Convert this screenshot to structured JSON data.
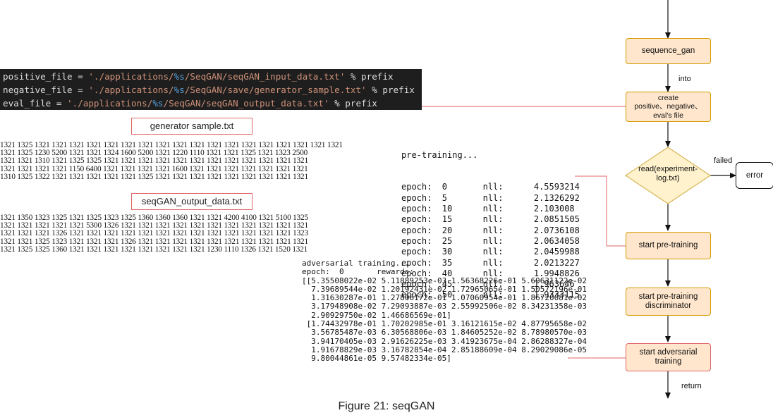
{
  "code": {
    "lines": [
      [
        {
          "t": "plain",
          "v": "positive_file = "
        },
        {
          "t": "str",
          "v": "'./applications/"
        },
        {
          "t": "fmt",
          "v": "%s"
        },
        {
          "t": "str",
          "v": "/SeqGAN/seqGAN_input_data.txt'"
        },
        {
          "t": "plain",
          "v": " % prefix"
        }
      ],
      [
        {
          "t": "plain",
          "v": "negative_file = "
        },
        {
          "t": "str",
          "v": "'./applications/"
        },
        {
          "t": "fmt",
          "v": "%s"
        },
        {
          "t": "str",
          "v": "/SeqGAN/save/generator_sample.txt'"
        },
        {
          "t": "plain",
          "v": " % prefix"
        }
      ],
      [
        {
          "t": "plain",
          "v": "eval_file = "
        },
        {
          "t": "str",
          "v": "'./applications/"
        },
        {
          "t": "fmt",
          "v": "%s"
        },
        {
          "t": "str",
          "v": "/SeqGAN/seqGAN_output_data.txt'"
        },
        {
          "t": "plain",
          "v": " % prefix"
        }
      ]
    ],
    "colors": {
      "plain": "#dcdcdc",
      "str": "#ce9178",
      "fmt": "#569cd6"
    }
  },
  "generator_label": "generator sample.txt",
  "generator_rows": [
    "1321 1325 1321 1321 1321 1321 1321 1321 1321 1321 1321 1321 1321 1321 1321 1321 1321 1321 1321 1321",
    "1321 1325 1230 5200 1321 1321 1324 1600 5200 1321 1220 1110 1321 1321 1325 1321 1323 2500",
    "1321 1321 1310 1321 1325 1325 1321 1321 1321 1321 1321 1321 1321 1321 1321 1321 1321 1321",
    "1321 1321 1321 1321 1150 6400 1321 1321 1321 1321 1600 1321 1321 1321 1321 1321 1321 1321",
    "1310 1325 1322 1321 1321 1321 1321 1321 1325 1321 1321 1321 1321 1321 1321 1321 1321 1321"
  ],
  "output_label": "seqGAN_output_data.txt",
  "output_rows": [
    "1321 1350 1323 1325 1321 1325 1323 1325 1360 1360 1360 1321 1321 4200 4100 1321 5100 1325",
    "1321 1321 1321 1321 1321 5300 1326 1321 1321 1321 1321 1321 1321 1321 1321 1321 1321 1321",
    "1321 1321 1321 1326 1321 1321 1321 1321 1321 1321 1321 1321 1321 1321 1321 1321 1321 1323",
    "1321 1321 1325 1323 1321 1321 1321 1326 1321 1321 1321 1321 1321 1321 1321 1321 1321 1321",
    "1321 1325 1325 1360 1321 1321 1321 1321 1321 1321 1321 1321 1230 1110 1326 1321 1520 1321"
  ],
  "pretraining": {
    "header": "pre-training...",
    "rows": [
      "epoch:  0       nll:      4.5593214",
      "epoch:  5       nll:      2.1326292",
      "epoch:  10      nll:      2.103008",
      "epoch:  15      nll:      2.0851505",
      "epoch:  20      nll:      2.0736108",
      "epoch:  25      nll:      2.0634058",
      "epoch:  30      nll:      2.0459988",
      "epoch:  35      nll:      2.0213227",
      "epoch:  40      nll:      1.9948826",
      "epoch:  45      nll:      1.963646",
      "epoch:  50      nll:      1.9333115"
    ]
  },
  "adversarial": {
    "lines": [
      "adversarial training...",
      "epoch:  0       rewards:",
      "[[5.35508022e-02 5.11889253e-03 1.56368226e-01 5.69631122e-02",
      "  7.39689544e-02 1.20192431e-02 1.72965065e-01 1.50572196e-01",
      "  1.31630287e-01 1.27806172e-01 1.07060954e-01 1.86720081e-02",
      "  3.17948908e-02 7.29093887e-03 2.55992506e-02 8.34231358e-03",
      "  2.90929750e-02 1.46686569e-01]",
      " [1.74432978e-01 1.70202985e-01 3.16121615e-02 4.87795658e-02",
      "  3.56785487e-03 6.30568806e-03 1.84605252e-02 8.78980570e-03",
      "  3.94170405e-03 2.91626225e-03 3.41923675e-04 2.86288327e-04",
      "  1.91678829e-03 3.16782854e-04 2.85188609e-04 8.29029086e-05",
      "  9.80044861e-05 9.57482334e-05]"
    ]
  },
  "flow": {
    "sequence_gan": "sequence_gan",
    "into": "into",
    "create": [
      "create",
      "positive、negative、",
      "eval's file"
    ],
    "read": [
      "read(experiment-",
      "log.txt)"
    ],
    "failed": "failed",
    "error": "error",
    "start_pretraining": "start pre-training",
    "start_pretraining_disc": [
      "start pre-training",
      "discriminator"
    ],
    "start_adversarial": [
      "start adversarial",
      "training"
    ],
    "return": "return"
  },
  "caption": "Figure 21: seqGAN"
}
